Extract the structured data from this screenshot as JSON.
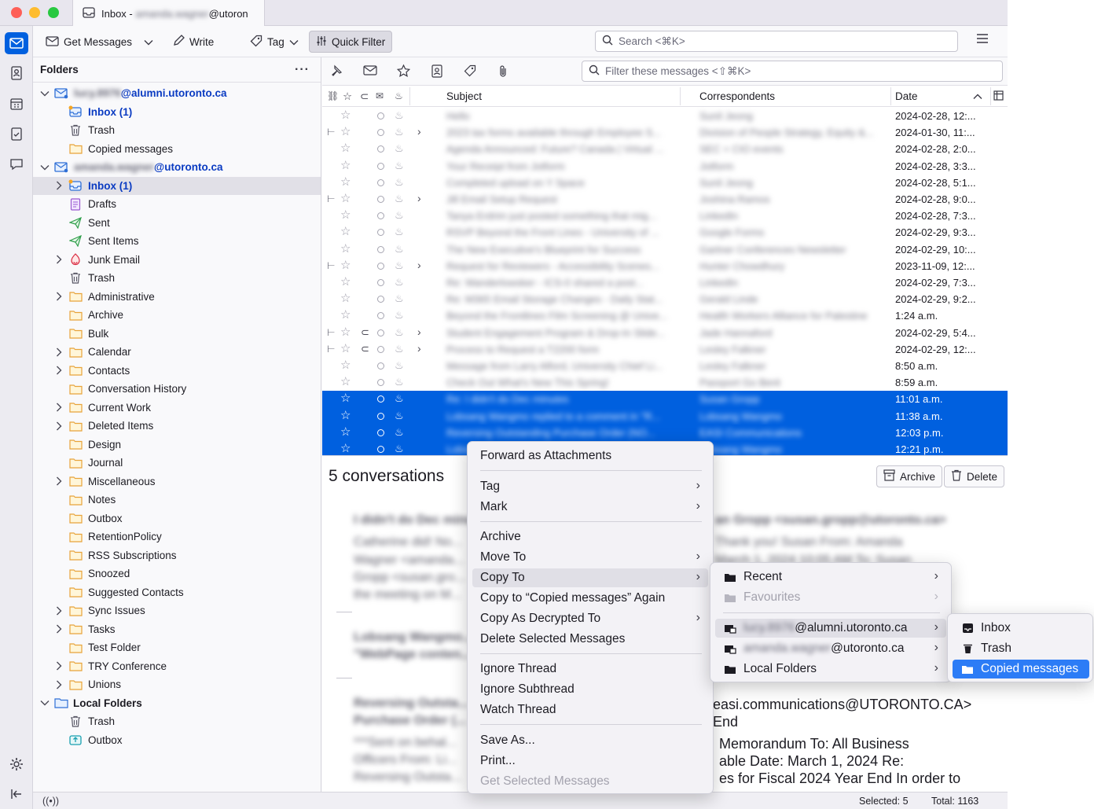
{
  "window": {
    "tab_title": "Inbox - ",
    "tab_account_redacted": "amanda.wagner",
    "tab_domain": "@utoron"
  },
  "toolbar": {
    "get_messages": "Get Messages",
    "write": "Write",
    "tag": "Tag",
    "quick_filter": "Quick Filter",
    "search_placeholder": "Search <⌘K>"
  },
  "folders": {
    "header": "Folders",
    "account1_user": "lucy.8976",
    "account1_domain": "@alumni.utoronto.ca",
    "account2_user": "amanda.wagner",
    "account2_domain": "@utoronto.ca",
    "items": [
      "Inbox (1)",
      "Trash",
      "Copied messages",
      "Inbox (1)",
      "Drafts",
      "Sent",
      "Sent Items",
      "Junk Email",
      "Trash",
      "Administrative",
      "Archive",
      "Bulk",
      "Calendar",
      "Contacts",
      "Conversation History",
      "Current Work",
      "Deleted Items",
      "Design",
      "Journal",
      "Miscellaneous",
      "Notes",
      "Outbox",
      "RetentionPolicy",
      "RSS Subscriptions",
      "Snoozed",
      "Suggested Contacts",
      "Sync Issues",
      "Tasks",
      "Test Folder",
      "TRY Conference",
      "Unions",
      "Local Folders",
      "Trash",
      "Outbox"
    ]
  },
  "thread": {
    "filter_placeholder": "Filter these messages <⇧⌘K>",
    "col_subject": "Subject",
    "col_correspondents": "Correspondents",
    "col_date": "Date",
    "rows": [
      {
        "subject": "Hello",
        "corr": "Sunil Jeong",
        "date": "2024-02-28, 12:..."
      },
      {
        "subject": "2023 tax forms available through Employee S...",
        "corr": "Division of People Strategy, Equity &...",
        "date": "2024-01-30, 11:..."
      },
      {
        "subject": "Agenda Announced: Future? Canada | Virtual ...",
        "corr": "SEC + CIO events",
        "date": "2024-02-28, 2:0..."
      },
      {
        "subject": "Your Receipt from Jotform",
        "corr": "Jotform",
        "date": "2024-02-28, 3:3..."
      },
      {
        "subject": "Completed upload on Y Space",
        "corr": "Sunil Jeong",
        "date": "2024-02-28, 5:1..."
      },
      {
        "subject": "Jill Email Setup Request",
        "corr": "Joshina Ramos",
        "date": "2024-02-28, 9:0..."
      },
      {
        "subject": "Tanya Erdrim just posted something that mig...",
        "corr": "LinkedIn",
        "date": "2024-02-28, 7:3..."
      },
      {
        "subject": "RSVP Beyond the Front Lines - University of ...",
        "corr": "Google Forms",
        "date": "2024-02-29, 9:3..."
      },
      {
        "subject": "The New Executive's Blueprint for Success",
        "corr": "Gartner Conferences Newsletter",
        "date": "2024-02-29, 10:..."
      },
      {
        "subject": "Request for Reviewers - Accessibility Scenes...",
        "corr": "Hunter Chowdhury",
        "date": "2023-11-09, 12:..."
      },
      {
        "subject": "Re: Wanderlowsker - ICS-0 shared a post...",
        "corr": "LinkedIn",
        "date": "2024-02-29, 7:3..."
      },
      {
        "subject": "Re: M365 Email Storage Changes - Daily Stat...",
        "corr": "Gerald Linde",
        "date": "2024-02-29, 9:2..."
      },
      {
        "subject": "Beyond the Frontlines Film Screening @ Unive...",
        "corr": "Health Workers Alliance for Palestine",
        "date": "1:24 a.m."
      },
      {
        "subject": "Student Engagement Program & Drop-In Slide...",
        "corr": "Jade Hannaford",
        "date": "2024-02-29, 5:4..."
      },
      {
        "subject": "Process to Request a T2200 form",
        "corr": "Lesley Falkner",
        "date": "2024-02-29, 12:..."
      },
      {
        "subject": "Message from Larry Alford, University Chief Li...",
        "corr": "Lesley Falkner",
        "date": "8:50 a.m."
      },
      {
        "subject": "Check Out What's New This Spring!",
        "corr": "Passport Go Beré",
        "date": "8:59 a.m."
      },
      {
        "subject": "Re: I didn't do Dec minutes",
        "corr": "Susan Gropp",
        "date": "11:01 a.m."
      },
      {
        "subject": "Lobsang Wangmo replied to a comment in \"R...",
        "corr": "Lobsang Wangmo",
        "date": "11:38 a.m."
      },
      {
        "subject": "Reversing Outstanding Purchase Order (NO...",
        "corr": "EASI Communications",
        "date": "12:03 p.m."
      },
      {
        "subject": "Lobsang Wangmo",
        "corr": "Lobsang Wangmo",
        "date": "12:21 p.m."
      }
    ]
  },
  "summary": {
    "title": "5 conversations",
    "archive": "Archive",
    "delete": "Delete",
    "line1_right": "an Gropp <susan.gropp@utoronto.ca>",
    "line_easi": "easi.communications@UTORONTO.CA>",
    "line_end": "End",
    "memo1": "Memorandum To: All Business",
    "memo2": "able Date: March 1, 2024 Re:",
    "memo3": "es for Fiscal 2024 Year End In order to",
    "blur1": "I didn't do Dec minutes",
    "blur2": "Catherine did! No...",
    "blur3": "Wagner <amanda...",
    "blur4": "Gropp <susan.gro...",
    "blur5": "the meeting on M...",
    "blur6": "Lobsang Wangmo...",
    "blur7": "\"WebPage conten...",
    "blur8": "Reversing Outsta...",
    "blur9": "Purchase Order (...",
    "blur10": "***Sent on behal...",
    "blur11": "Officers From: Li...",
    "blur12": "Reversing Outsta...",
    "blur_r1": "Thank you! Susan From: Amanda",
    "blur_r2": "March 1, 2024 10:05 AM To: Susan"
  },
  "status": {
    "selected": "Selected: 5",
    "total": "Total: 1163"
  },
  "context_menu": {
    "forward": "Forward as Attachments",
    "tag": "Tag",
    "mark": "Mark",
    "archive": "Archive",
    "move_to": "Move To",
    "copy_to": "Copy To",
    "copy_again": "Copy to “Copied messages” Again",
    "copy_decrypted": "Copy As Decrypted To",
    "delete_selected": "Delete Selected Messages",
    "ignore_thread": "Ignore Thread",
    "ignore_subthread": "Ignore Subthread",
    "watch_thread": "Watch Thread",
    "save_as": "Save As...",
    "print": "Print...",
    "get_selected": "Get Selected Messages"
  },
  "copy_submenu": {
    "recent": "Recent",
    "favourites": "Favourites",
    "acct1_user": "lucy.8976",
    "acct1_domain": "@alumni.utoronto.ca",
    "acct2_user": "amanda.wagner",
    "acct2_domain": "@utoronto.ca",
    "local": "Local Folders"
  },
  "folder_submenu": {
    "inbox": "Inbox",
    "trash": "Trash",
    "copied": "Copied messages"
  },
  "colors": {
    "accent": "#0060df",
    "highlight": "#2c7cf6",
    "unread_blue": "#0a3bc2"
  }
}
